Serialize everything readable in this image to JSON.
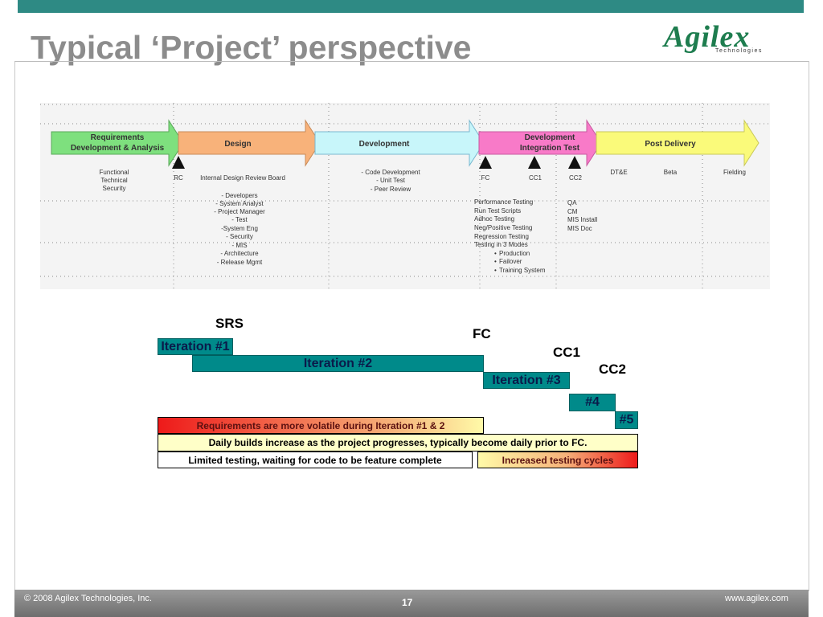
{
  "slide": {
    "title": "Typical ‘Project’ perspective",
    "logo_text": "Agilex",
    "logo_subtext": "Technologies"
  },
  "phases": [
    {
      "label_line1": "Requirements",
      "label_line2": "Development & Analysis",
      "color": "#7ee07e"
    },
    {
      "label_line1": "Design",
      "label_line2": "",
      "color": "#f8b27a"
    },
    {
      "label_line1": "Development",
      "label_line2": "",
      "color": "#c8f6fa"
    },
    {
      "label_line1": "Development",
      "label_line2": "Integration Test",
      "color": "#f87ac8"
    },
    {
      "label_line1": "Post Delivery",
      "label_line2": "",
      "color": "#fafa7a"
    }
  ],
  "gates": {
    "rc": "RC",
    "fc": "FC",
    "cc1": "CC1",
    "cc2": "CC2",
    "dte": "DT&E",
    "beta": "Beta",
    "fielding": "Fielding"
  },
  "details": {
    "requirements": [
      "Functional",
      "Technical",
      "Security"
    ],
    "design_board": "Internal Design Review Board",
    "design_roles": [
      "- Developers",
      "- System Analyst",
      "- Project Manager",
      "- Test",
      "-System Eng",
      "- Security",
      "- MIS",
      "- Architecture",
      "- Release Mgmt"
    ],
    "development": [
      "- Code Development",
      "- Unit Test",
      "- Peer Review"
    ],
    "integration": [
      "Performance  Testing",
      "Run Test Scripts",
      "Adhoc Testing",
      "Neg/Positive Testing",
      "Regression Testing",
      "Testing in 3 Modes"
    ],
    "modes": [
      "Production",
      "Failover",
      "Training System"
    ],
    "post": [
      "QA",
      "CM",
      "MIS Install",
      "MIS Doc"
    ]
  },
  "milestones": {
    "srs": "SRS",
    "fc": "FC",
    "cc1": "CC1",
    "cc2": "CC2"
  },
  "iterations": [
    "Iteration #1",
    "Iteration #2",
    "Iteration #3",
    "#4",
    "#5"
  ],
  "notes": {
    "requirements_volatile": "Requirements are more volatile during Iteration #1 & 2",
    "daily_builds": "Daily builds increase as the project progresses, typically become daily prior to FC.",
    "limited_testing": "Limited testing, waiting for code to be feature complete",
    "increased_testing": "Increased testing cycles"
  },
  "footer": {
    "copyright": "© 2008 Agilex Technologies, Inc.",
    "page": "17",
    "url": "www.agilex.com"
  }
}
